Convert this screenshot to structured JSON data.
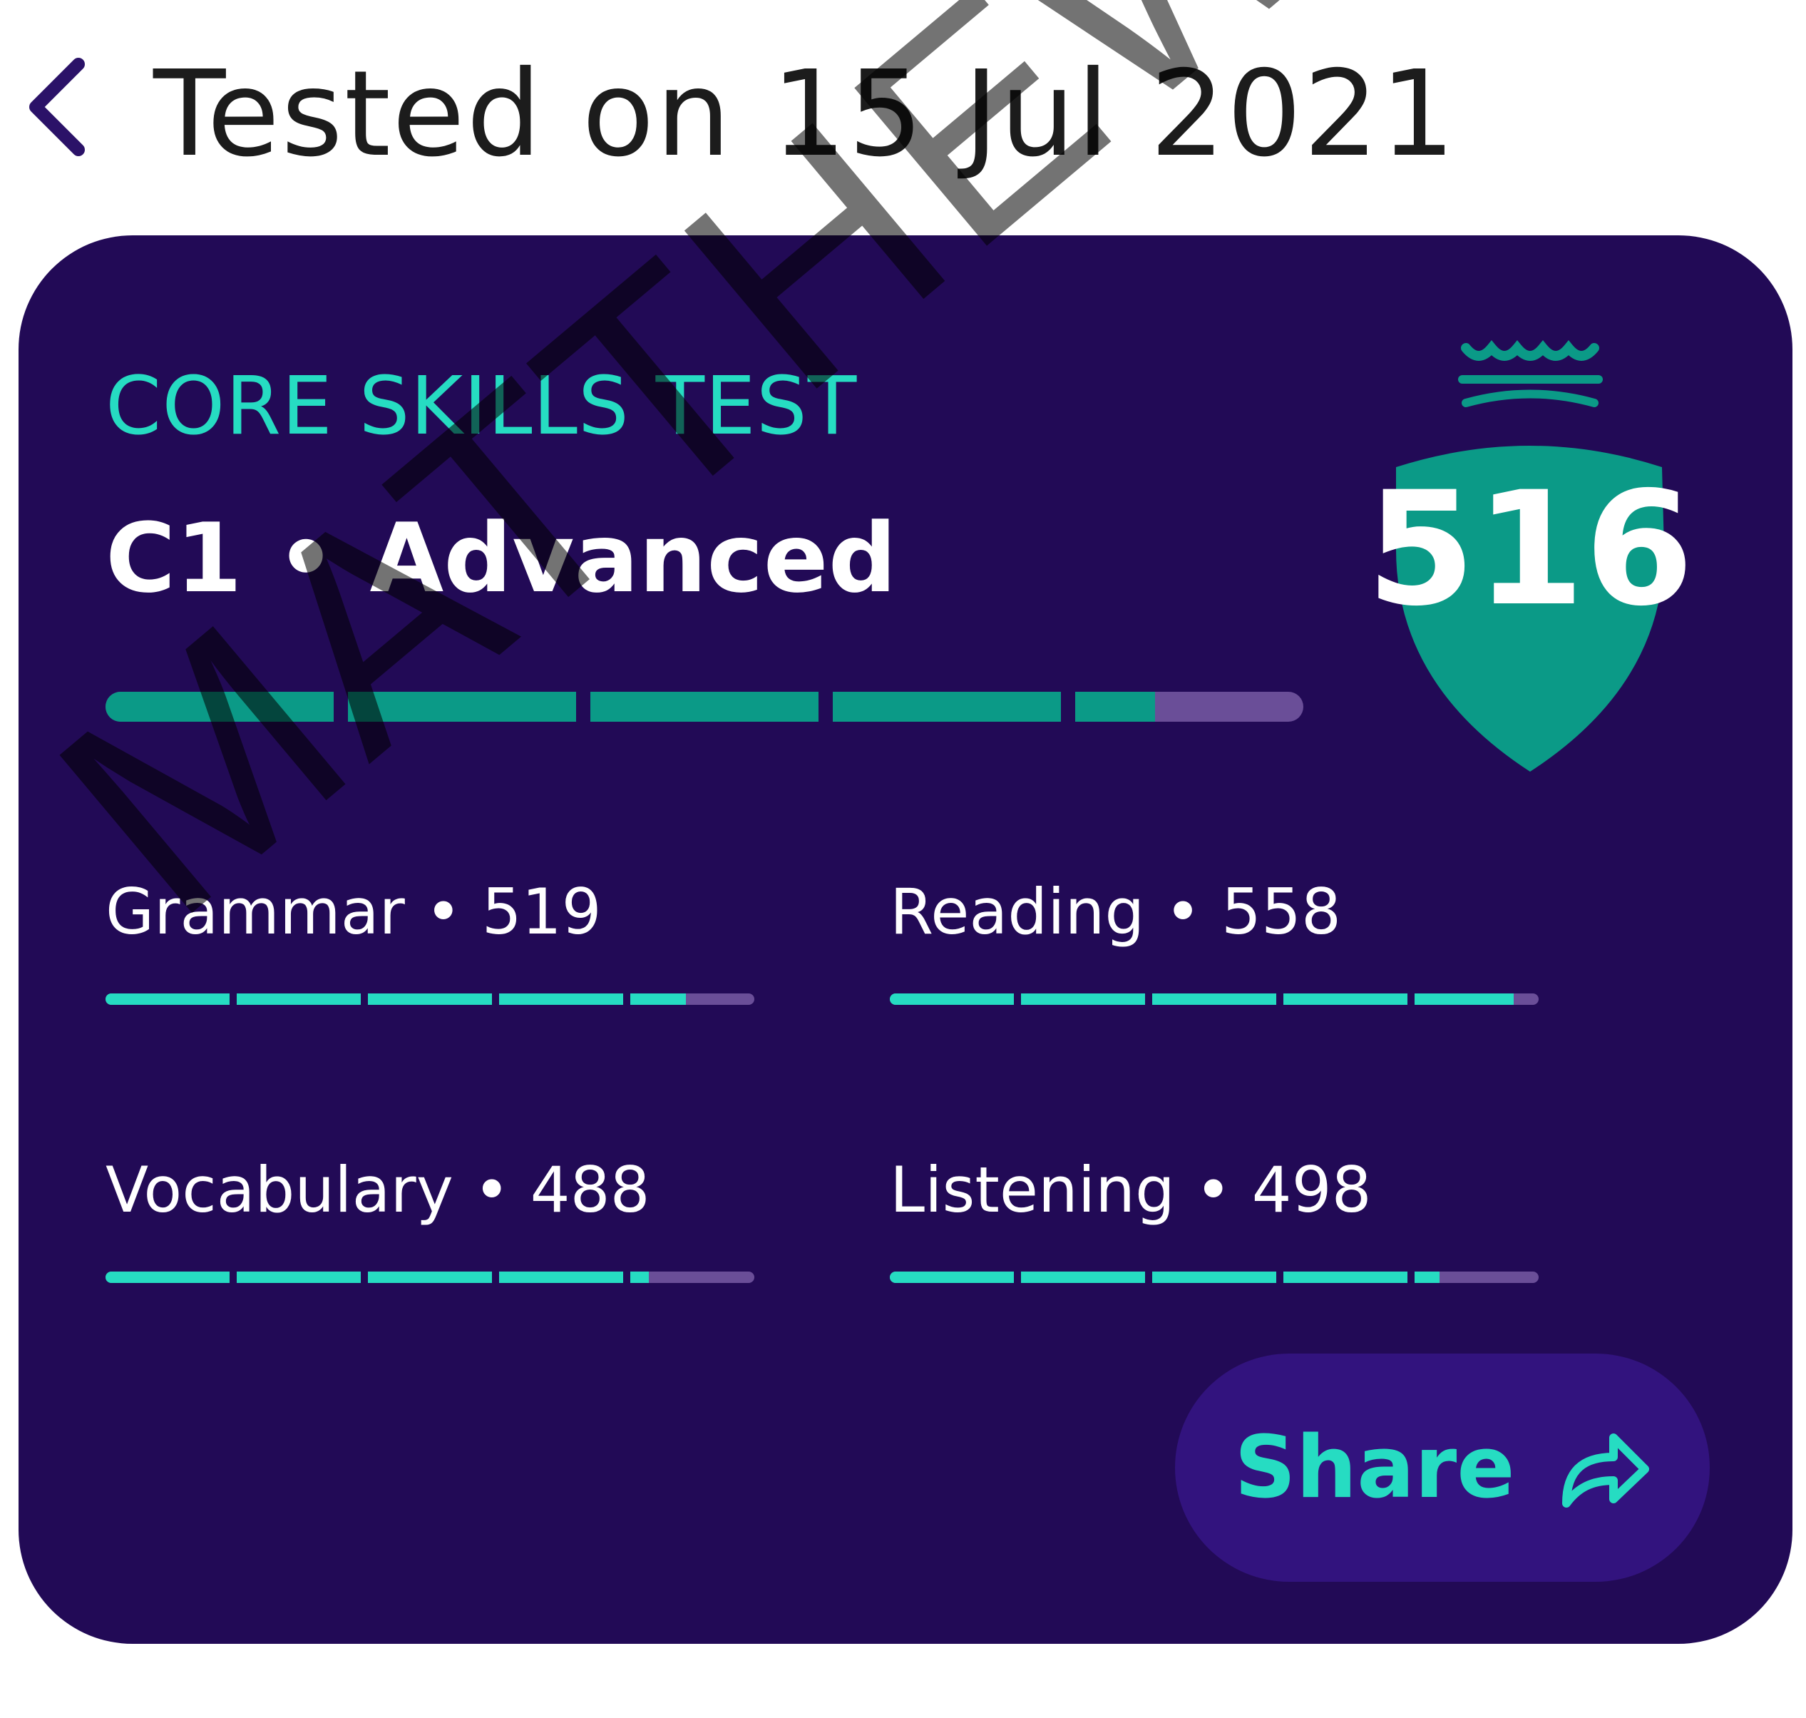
{
  "header": {
    "title": "Tested on 15 Jul 2021",
    "back_icon": "chevron-left-icon"
  },
  "result": {
    "test_name": "CORE SKILLS TEST",
    "level": "C1 • Advanced",
    "overall_score": "516",
    "overall_progress_fraction": 0.87,
    "badge_icon": "shield-crown-icon"
  },
  "skills": [
    {
      "label": "Grammar • 519",
      "progress_fraction": 0.89
    },
    {
      "label": "Reading • 558",
      "progress_fraction": 0.96
    },
    {
      "label": "Vocabulary • 488",
      "progress_fraction": 0.83
    },
    {
      "label": "Listening • 498",
      "progress_fraction": 0.84
    }
  ],
  "share": {
    "label": "Share",
    "icon": "share-arrow-icon"
  },
  "watermark": "MATTHEW",
  "colors": {
    "card_bg": "#220a56",
    "accent_teal": "#26dcc2",
    "shield": "#0b9a87",
    "button_bg": "#32137e",
    "bar_track": "#6a4e98"
  }
}
